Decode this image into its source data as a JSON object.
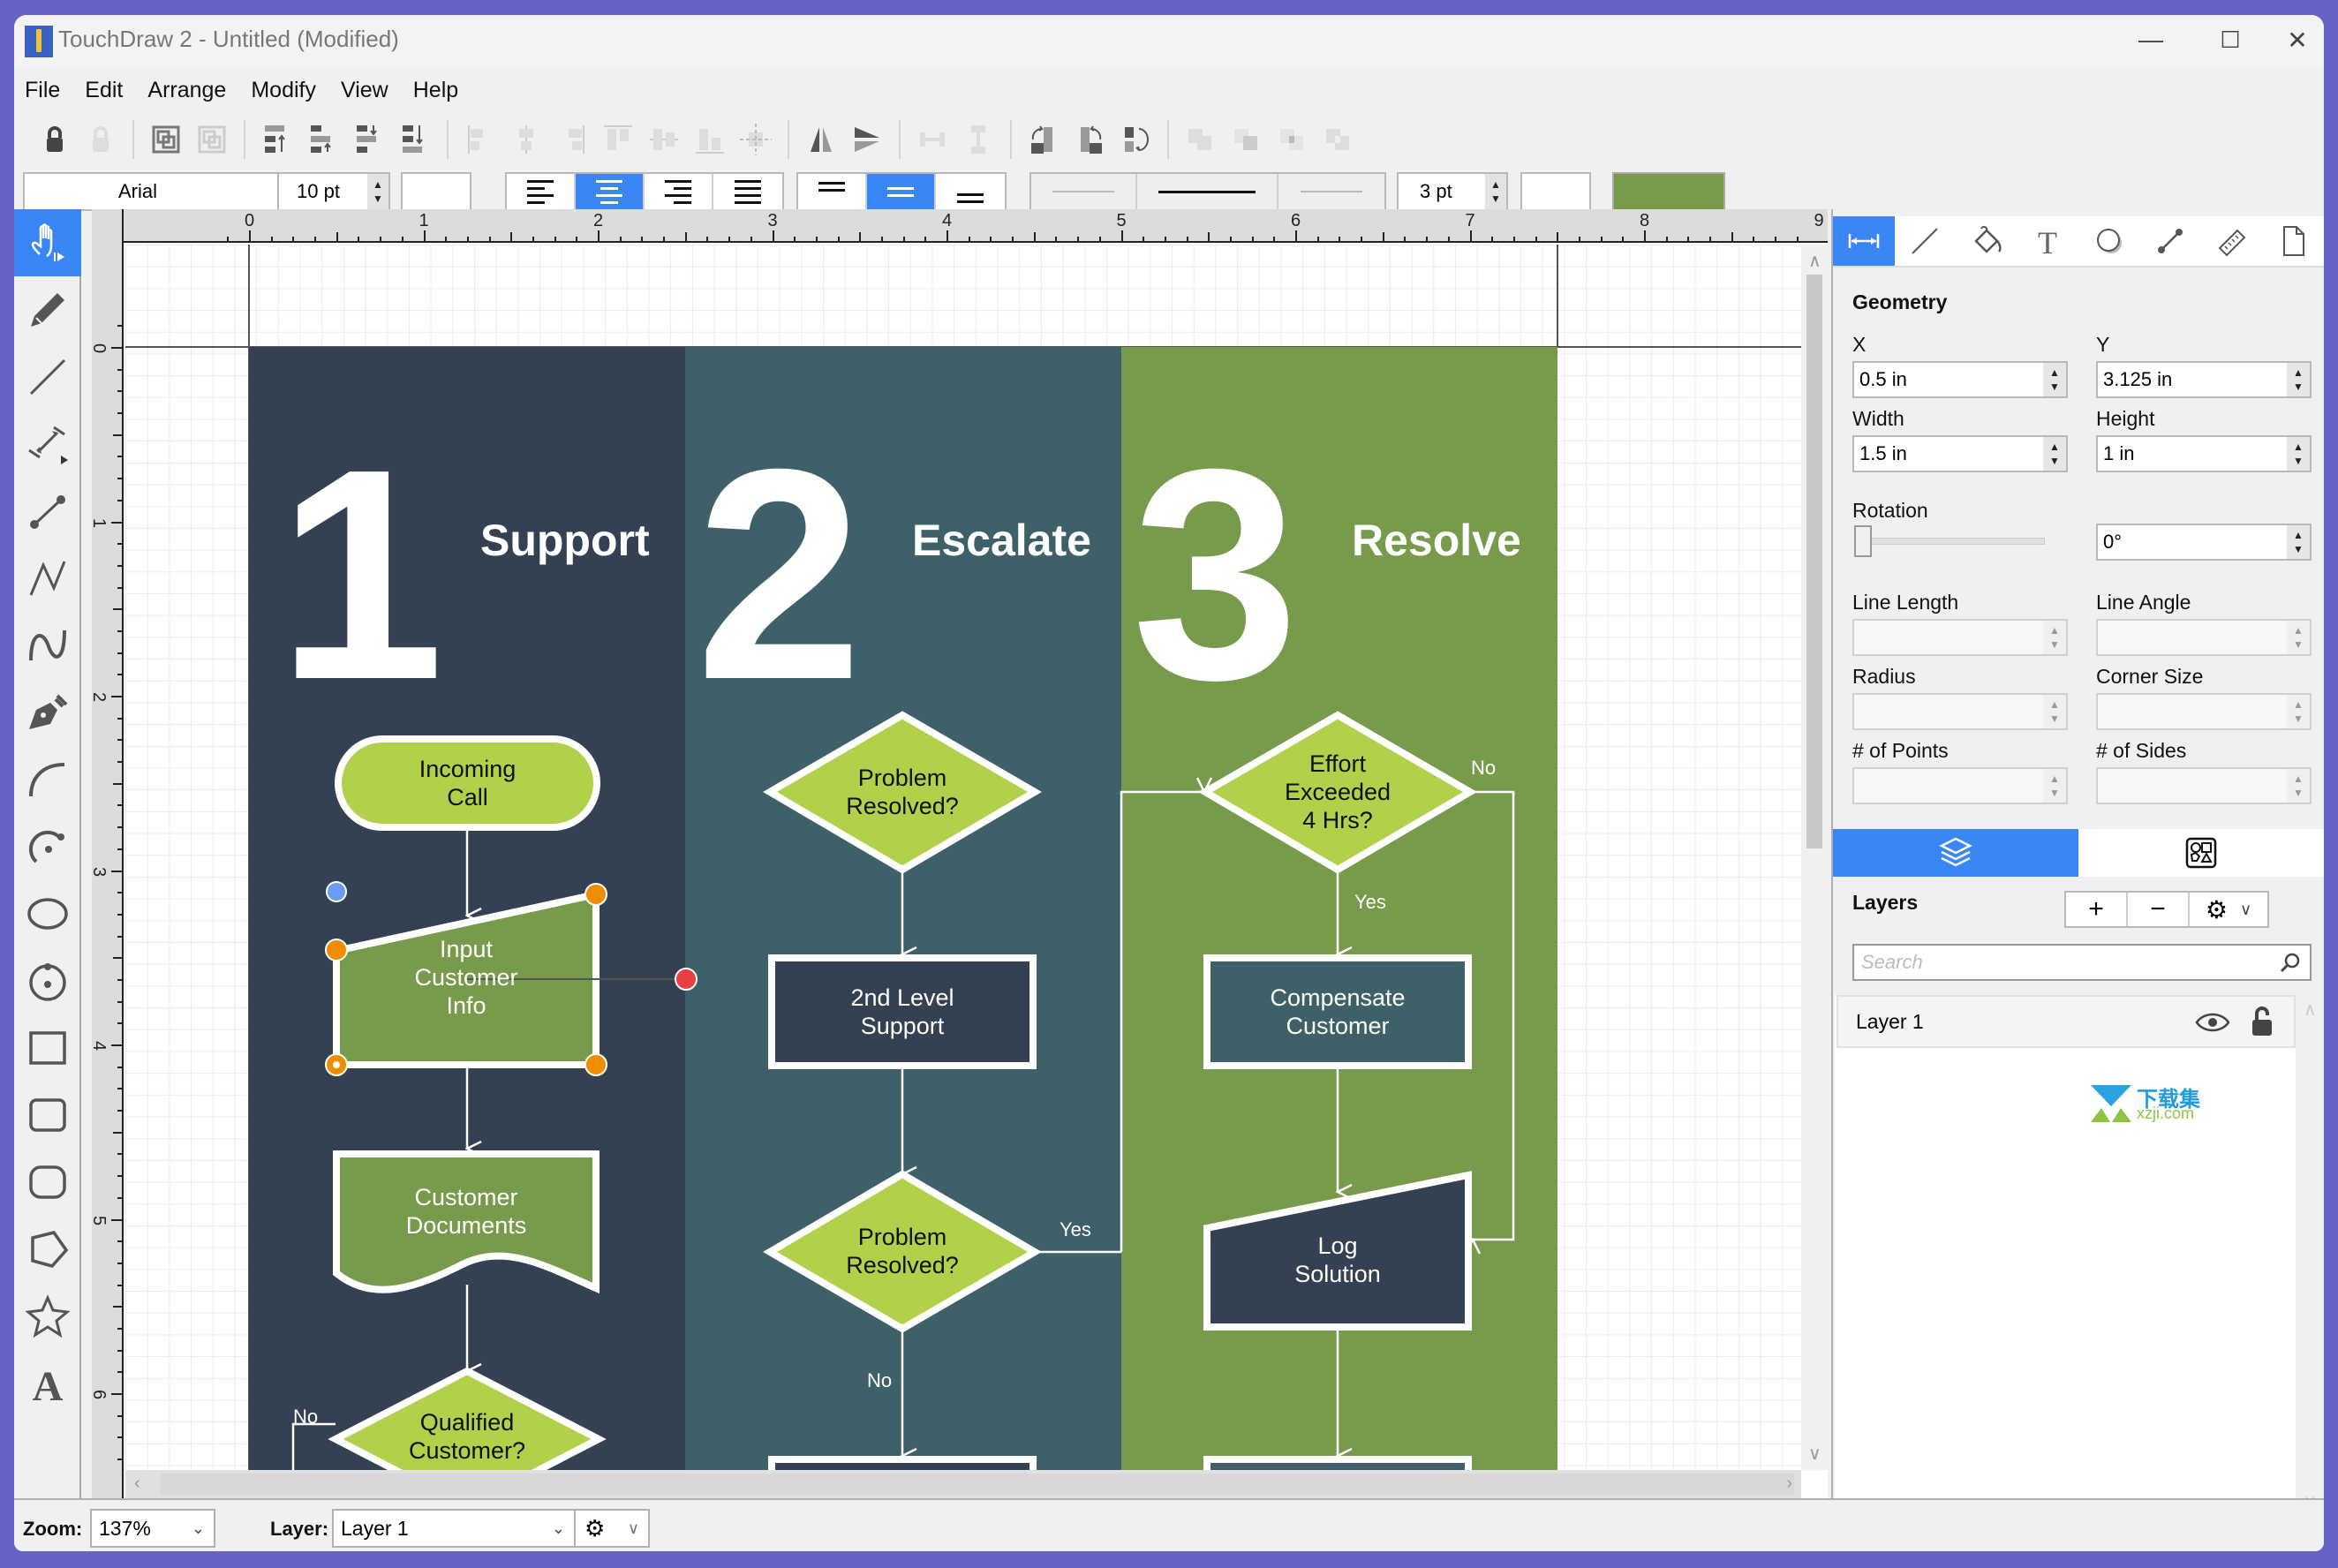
{
  "window": {
    "title": "TouchDraw 2 - Untitled (Modified)",
    "controls": {
      "minimize": "—",
      "maximize": "☐",
      "close": "✕"
    }
  },
  "menu": [
    "File",
    "Edit",
    "Arrange",
    "Modify",
    "View",
    "Help"
  ],
  "toolbar": {
    "font_family": "Arial",
    "font_size": "10 pt",
    "text_align_selected": "center",
    "vertical_align_selected": "middle",
    "stroke_width": "3 pt",
    "fill_color": "#779a4b"
  },
  "tools": [
    {
      "name": "select",
      "active": true
    },
    {
      "name": "pencil"
    },
    {
      "name": "line"
    },
    {
      "name": "dimension"
    },
    {
      "name": "connector"
    },
    {
      "name": "polyline"
    },
    {
      "name": "curve"
    },
    {
      "name": "pen"
    },
    {
      "name": "arc"
    },
    {
      "name": "arc-center"
    },
    {
      "name": "ellipse"
    },
    {
      "name": "circle-center"
    },
    {
      "name": "rectangle"
    },
    {
      "name": "rounded-rectangle"
    },
    {
      "name": "rounded-rectangle-large"
    },
    {
      "name": "polygon"
    },
    {
      "name": "star"
    },
    {
      "name": "text"
    }
  ],
  "ruler": {
    "top": [
      "0",
      "1",
      "2",
      "3",
      "4",
      "5",
      "6",
      "7",
      "8",
      "9"
    ],
    "left": [
      "0",
      "1",
      "2",
      "3",
      "4",
      "5",
      "6"
    ]
  },
  "diagram": {
    "lanes": [
      {
        "number": "1",
        "title": "Support",
        "color": "#344152"
      },
      {
        "number": "2",
        "title": "Escalate",
        "color": "#3e6068"
      },
      {
        "number": "3",
        "title": "Resolve",
        "color": "#779a4b"
      }
    ],
    "nodes": {
      "incoming_call": "Incoming\nCall",
      "input_customer_info": "Input\nCustomer\nInfo",
      "customer_documents": "Customer\nDocuments",
      "qualified_customer": "Qualified\nCustomer?",
      "problem_resolved_1": "Problem\nResolved?",
      "second_level_support": "2nd Level\nSupport",
      "problem_resolved_2": "Problem\nResolved?",
      "effort_exceeded": "Effort\nExceeded\n4 Hrs?",
      "compensate_customer": "Compensate\nCustomer",
      "log_solution": "Log\nSolution"
    },
    "labels": {
      "no_qualified": "No",
      "yes_problem2": "Yes",
      "no_problem2": "No",
      "no_effort": "No",
      "yes_effort": "Yes"
    },
    "colors": {
      "lime": "#b1d14a",
      "green": "#779a4b",
      "dark": "#344152",
      "teal": "#3e6068",
      "handle": "#f08c00",
      "rotate_handle": "#6a9cf2",
      "connect_handle": "#e84040"
    }
  },
  "inspector": {
    "tabs": [
      "geometry",
      "stroke",
      "fill",
      "text",
      "shadow",
      "connection",
      "measure",
      "document"
    ],
    "section": "Geometry",
    "x_label": "X",
    "x_value": "0.5 in",
    "y_label": "Y",
    "y_value": "3.125 in",
    "width_label": "Width",
    "width_value": "1.5 in",
    "height_label": "Height",
    "height_value": "1 in",
    "rotation_label": "Rotation",
    "rotation_value": "0°",
    "rotation_fraction": 0,
    "line_length_label": "Line Length",
    "line_angle_label": "Line Angle",
    "radius_label": "Radius",
    "corner_size_label": "Corner Size",
    "points_label": "# of Points",
    "sides_label": "# of Sides"
  },
  "layers_panel": {
    "tabs": [
      "layers",
      "shapes"
    ],
    "title": "Layers",
    "add": "+",
    "remove": "−",
    "search_placeholder": "Search",
    "items": [
      {
        "name": "Layer 1",
        "visible": true,
        "locked": false
      }
    ]
  },
  "statusbar": {
    "zoom_label": "Zoom:",
    "zoom_value": "137%",
    "layer_label": "Layer:",
    "layer_value": "Layer 1"
  },
  "watermark": {
    "cn": "下载集",
    "url": "xzji.com"
  }
}
